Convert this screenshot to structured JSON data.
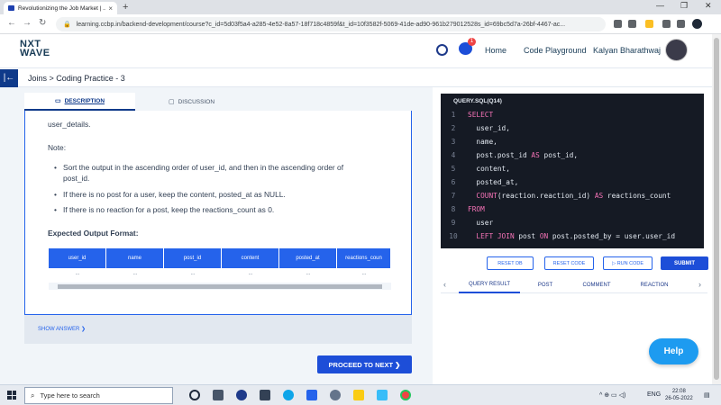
{
  "browser": {
    "tab_title": "Revolutionizing the Job Market | ...",
    "tab_close": "×",
    "new_tab": "+",
    "url": "learning.ccbp.in/backend-development/course?c_id=5d03f5a4-a285-4e52-8a57-18f718c4859f&t_id=10f3582f-5069-41de-ad90-961b279012528s_id=69bc5d7a-26bf-4467-ac...",
    "minimize": "—",
    "maximize": "❐",
    "close": "✕",
    "back": "←",
    "forward": "→",
    "reload": "↻",
    "lock": "🔒"
  },
  "header": {
    "logo_line1": "NXT",
    "logo_line2": "WAVE",
    "chat_badge": "1",
    "home": "Home",
    "code_playground": "Code Playground",
    "user_name": "Kalyan Bharathwaj"
  },
  "breadcrumb": {
    "toggle": "|←",
    "text": "Joins > Coding Practice - 3"
  },
  "left": {
    "tab_description": "DESCRIPTION",
    "tab_discussion": "DISCUSSION",
    "partial_line": "user_details.",
    "note_heading": "Note:",
    "bullets": [
      "Sort the output in the ascending order of user_id, and then in the ascending order of post_id.",
      "If there is no post for a user, keep the content, posted_at as NULL.",
      "If there is no reaction for a post, keep the reactions_count as 0."
    ],
    "expected_heading": "Expected Output Format:",
    "columns": [
      "user_id",
      "name",
      "post_id",
      "content",
      "posted_at",
      "reactions_coun"
    ],
    "row": [
      "...",
      "...",
      "...",
      "...",
      "...",
      "..."
    ],
    "show_answer": "SHOW ANSWER ❯",
    "proceed": "PROCEED TO NEXT ❯"
  },
  "editor": {
    "title": "QUERY.SQL(Q14)",
    "lines": [
      {
        "n": "1",
        "parts": [
          {
            "t": "SELECT",
            "k": true
          }
        ]
      },
      {
        "n": "2",
        "parts": [
          {
            "t": "  user_id,",
            "k": false
          }
        ]
      },
      {
        "n": "3",
        "parts": [
          {
            "t": "  name,",
            "k": false
          }
        ]
      },
      {
        "n": "4",
        "parts": [
          {
            "t": "  post.post_id ",
            "k": false
          },
          {
            "t": "AS",
            "k": true
          },
          {
            "t": " post_id,",
            "k": false
          }
        ]
      },
      {
        "n": "5",
        "parts": [
          {
            "t": "  content,",
            "k": false
          }
        ]
      },
      {
        "n": "6",
        "parts": [
          {
            "t": "  posted_at,",
            "k": false
          }
        ]
      },
      {
        "n": "7",
        "parts": [
          {
            "t": "  COUNT",
            "k": true
          },
          {
            "t": "(reaction.reaction_id) ",
            "k": false
          },
          {
            "t": "AS",
            "k": true
          },
          {
            "t": " reactions_count",
            "k": false
          }
        ]
      },
      {
        "n": "8",
        "parts": [
          {
            "t": "FROM",
            "k": true
          }
        ]
      },
      {
        "n": "9",
        "parts": [
          {
            "t": "  user",
            "k": false
          }
        ]
      },
      {
        "n": "10",
        "parts": [
          {
            "t": "  ",
            "k": false
          },
          {
            "t": "LEFT JOIN",
            "k": true
          },
          {
            "t": " post ",
            "k": false
          },
          {
            "t": "ON",
            "k": true
          },
          {
            "t": " post.posted_by = user.user_id",
            "k": false
          }
        ]
      }
    ],
    "reset_db": "RESET DB",
    "reset_code": "RESET CODE",
    "run_code": "▷ RUN CODE",
    "submit": "SUBMIT"
  },
  "results": {
    "tabs": [
      "QUERY RESULT",
      "POST",
      "COMMENT",
      "REACTION"
    ],
    "prev": "‹",
    "next": "›"
  },
  "help": "Help",
  "taskbar": {
    "search_placeholder": "Type here to search",
    "lang": "ENG",
    "time": "22:08",
    "date": "26-05-2022"
  }
}
